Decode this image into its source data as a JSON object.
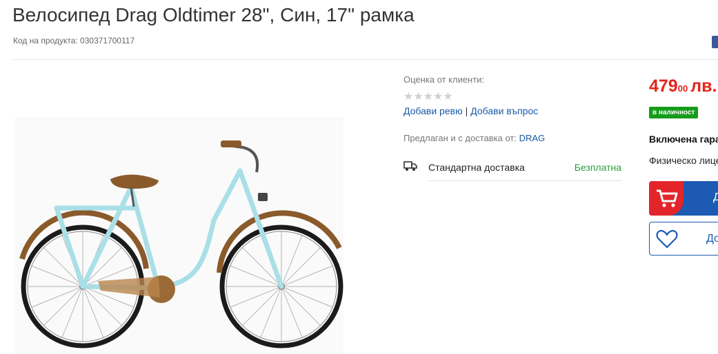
{
  "product": {
    "title": "Велосипед Drag Oldtimer 28\", Син, 17\" рамка",
    "sku": "Код на продукта: 030371700117",
    "image_icon": "bicycle-image"
  },
  "reviews": {
    "label": "Оценка от клиенти:",
    "stars": "★★★★★",
    "add_review": "Добави ревю",
    "separator": "|",
    "add_question": "Добави въпрос"
  },
  "seller": {
    "prefix": "Предлаган и с доставка от:",
    "name": "DRAG"
  },
  "delivery": {
    "icon": "truck-icon",
    "label": "Стандартна доставка",
    "price": "Безплатна",
    "price_color": "#2a9d3a"
  },
  "pricing": {
    "integer": "479",
    "decimals": "00",
    "currency": "лв.",
    "color": "#e4241b"
  },
  "stock": {
    "label": "в наличност",
    "color": "#169c1a"
  },
  "warranty_label": "Включена гара",
  "customer_type": "Физическо лице",
  "actions": {
    "add_to_cart": "Д",
    "wishlist": "До",
    "cart_icon": "cart-icon",
    "heart_icon": "heart-icon",
    "primary_color": "#1c5ab3",
    "accent_color": "#e3242b"
  }
}
